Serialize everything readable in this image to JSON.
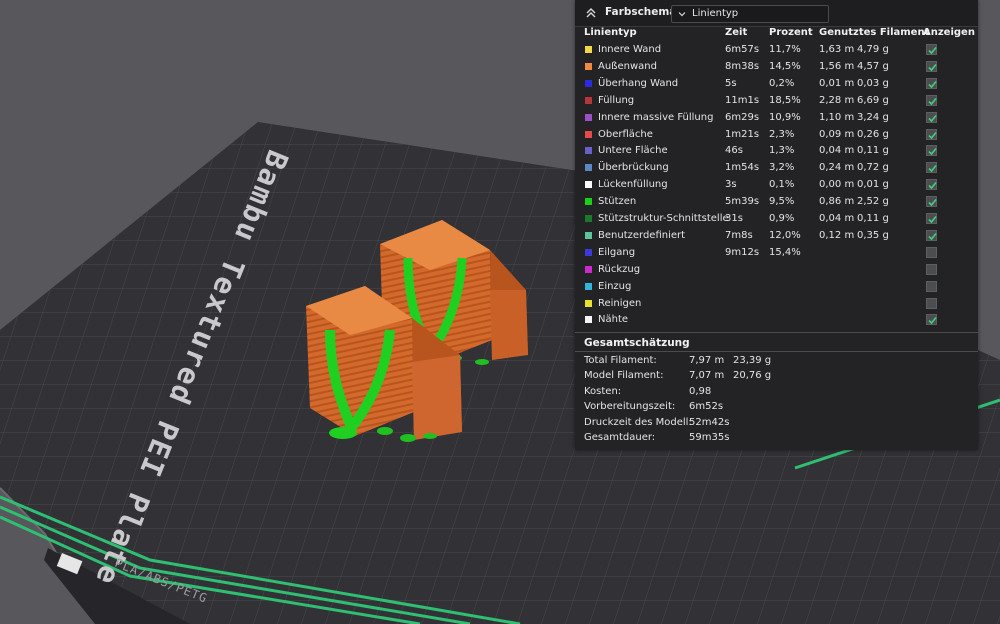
{
  "legend": {
    "title": "Farbschema",
    "view_mode": "Linientyp",
    "columns": {
      "type": "Linientyp",
      "time": "Zeit",
      "percent": "Prozent",
      "filament": "Genutztes Filament",
      "show": "Anzeigen"
    },
    "rows": [
      {
        "name": "Innere Wand",
        "time": "6m57s",
        "percent": "11,7%",
        "length": "1,63 m",
        "weight": "4,79 g",
        "color": "#f1d84a",
        "shown": true
      },
      {
        "name": "Außenwand",
        "time": "8m38s",
        "percent": "14,5%",
        "length": "1,56 m",
        "weight": "4,57 g",
        "color": "#f08a42",
        "shown": true
      },
      {
        "name": "Überhang Wand",
        "time": "5s",
        "percent": "0,2%",
        "length": "0,01 m",
        "weight": "0,03 g",
        "color": "#2b2be0",
        "shown": true
      },
      {
        "name": "Füllung",
        "time": "11m1s",
        "percent": "18,5%",
        "length": "2,28 m",
        "weight": "6,69 g",
        "color": "#b5353a",
        "shown": true
      },
      {
        "name": "Innere massive Füllung",
        "time": "6m29s",
        "percent": "10,9%",
        "length": "1,10 m",
        "weight": "3,24 g",
        "color": "#9c4fc7",
        "shown": true
      },
      {
        "name": "Oberfläche",
        "time": "1m21s",
        "percent": "2,3%",
        "length": "0,09 m",
        "weight": "0,26 g",
        "color": "#e84a4a",
        "shown": true
      },
      {
        "name": "Untere Fläche",
        "time": "46s",
        "percent": "1,3%",
        "length": "0,04 m",
        "weight": "0,11 g",
        "color": "#6660c8",
        "shown": true
      },
      {
        "name": "Überbrückung",
        "time": "1m54s",
        "percent": "3,2%",
        "length": "0,24 m",
        "weight": "0,72 g",
        "color": "#5b88c2",
        "shown": true
      },
      {
        "name": "Lückenfüllung",
        "time": "3s",
        "percent": "0,1%",
        "length": "0,00 m",
        "weight": "0,01 g",
        "color": "#ffffff",
        "shown": true
      },
      {
        "name": "Stützen",
        "time": "5m39s",
        "percent": "9,5%",
        "length": "0,86 m",
        "weight": "2,52 g",
        "color": "#18d018",
        "shown": true
      },
      {
        "name": "Stützstruktur-Schnittstelle",
        "time": "31s",
        "percent": "0,9%",
        "length": "0,04 m",
        "weight": "0,11 g",
        "color": "#1a7a2a",
        "shown": true
      },
      {
        "name": "Benutzerdefiniert",
        "time": "7m8s",
        "percent": "12,0%",
        "length": "0,12 m",
        "weight": "0,35 g",
        "color": "#5ec59a",
        "shown": true
      },
      {
        "name": "Eilgang",
        "time": "9m12s",
        "percent": "15,4%",
        "length": "",
        "weight": "",
        "color": "#3a3ad6",
        "shown": false
      },
      {
        "name": "Rückzug",
        "time": "",
        "percent": "",
        "length": "",
        "weight": "",
        "color": "#d028d0",
        "shown": false
      },
      {
        "name": "Einzug",
        "time": "",
        "percent": "",
        "length": "",
        "weight": "",
        "color": "#33b4d8",
        "shown": false
      },
      {
        "name": "Reinigen",
        "time": "",
        "percent": "",
        "length": "",
        "weight": "",
        "color": "#e8e030",
        "shown": false
      },
      {
        "name": "Nähte",
        "time": "",
        "percent": "",
        "length": "",
        "weight": "",
        "color": "#f4f4f4",
        "shown": true
      }
    ]
  },
  "estimate": {
    "title": "Gesamtschätzung",
    "rows": [
      {
        "label": "Total Filament:",
        "v1": "7,97 m",
        "v2": "23,39 g"
      },
      {
        "label": "Model Filament:",
        "v1": "7,07 m",
        "v2": "20,76 g"
      },
      {
        "label": "Kosten:",
        "v1": "0,98",
        "v2": ""
      },
      {
        "label": "Vorbereitungszeit:",
        "v1": "6m52s",
        "v2": ""
      },
      {
        "label": "Druckzeit des Modell:",
        "v1": "52m42s",
        "v2": ""
      },
      {
        "label": "Gesamtdauer:",
        "v1": "59m35s",
        "v2": ""
      }
    ]
  },
  "plate": {
    "label": "Bambu Textured PEI Plate",
    "tag": "PLA/ABS/PETG"
  },
  "colors": {
    "support_green": "#22d022",
    "model_orange": "#d8702f",
    "accent_green": "#2fbf72"
  }
}
